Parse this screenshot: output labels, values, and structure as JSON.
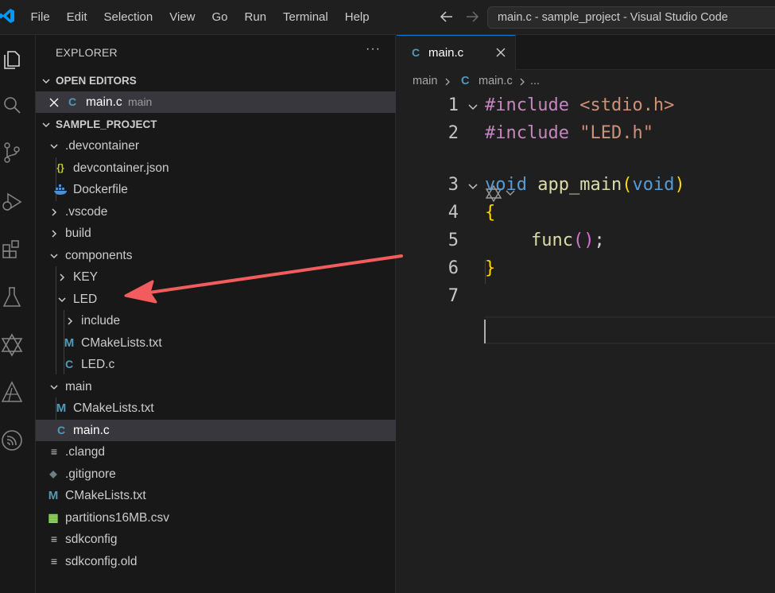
{
  "menu": [
    "File",
    "Edit",
    "Selection",
    "View",
    "Go",
    "Run",
    "Terminal",
    "Help"
  ],
  "window_title": "main.c - sample_project - Visual Studio Code",
  "sidebar": {
    "title": "EXPLORER",
    "more": "···",
    "open_editors_label": "OPEN EDITORS",
    "open_editor": {
      "icon": "C",
      "name": "main.c",
      "folder": "main"
    },
    "project_label": "SAMPLE_PROJECT",
    "tree": [
      {
        "label": ".devcontainer",
        "icon": ""
      },
      {
        "label": "devcontainer.json",
        "icon": "{}"
      },
      {
        "label": "Dockerfile",
        "icon": "docker-icon"
      },
      {
        "label": ".vscode",
        "icon": ""
      },
      {
        "label": "build",
        "icon": ""
      },
      {
        "label": "components",
        "icon": ""
      },
      {
        "label": "KEY",
        "icon": ""
      },
      {
        "label": "LED",
        "icon": ""
      },
      {
        "label": "include",
        "icon": ""
      },
      {
        "label": "CMakeLists.txt",
        "icon": "M"
      },
      {
        "label": "LED.c",
        "icon": "C"
      },
      {
        "label": "main",
        "icon": ""
      },
      {
        "label": "CMakeLists.txt",
        "icon": "M"
      },
      {
        "label": "main.c",
        "icon": "C"
      },
      {
        "label": ".clangd",
        "icon": "≡"
      },
      {
        "label": ".gitignore",
        "icon": "◆"
      },
      {
        "label": "CMakeLists.txt",
        "icon": "M"
      },
      {
        "label": "partitions16MB.csv",
        "icon": "▦"
      },
      {
        "label": "sdkconfig",
        "icon": "≡"
      },
      {
        "label": "sdkconfig.old",
        "icon": "≡"
      }
    ]
  },
  "editor": {
    "tab": {
      "icon": "C",
      "label": "main.c"
    },
    "breadcrumb": {
      "folder": "main",
      "sep": ">",
      "icon": "C",
      "file": "main.c",
      "rest": "..."
    },
    "code": {
      "l1": {
        "n": "1",
        "kw": "#include",
        "arg": "<stdio.h>"
      },
      "l2": {
        "n": "2",
        "kw": "#include",
        "arg": "\"LED.h\""
      },
      "l3": {
        "n": "3",
        "ret": "void",
        "name": "app_main",
        "open": "(",
        "param": "void",
        "close": ")"
      },
      "l4": {
        "n": "4",
        "brace": "{"
      },
      "l5": {
        "n": "5",
        "call": "func",
        "parens": "()",
        "semi": ";"
      },
      "l6": {
        "n": "6",
        "brace": "}"
      },
      "l7": {
        "n": "7"
      }
    }
  }
}
